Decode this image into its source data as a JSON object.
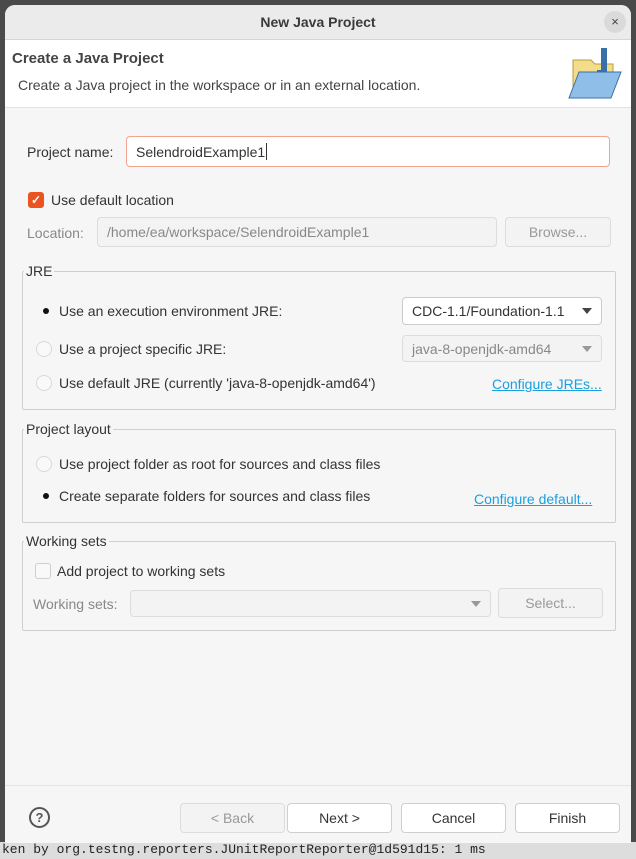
{
  "background": {
    "console_text": "ken by org.testng.reporters.JUnitReportReporter@1d591d15: 1 ms"
  },
  "dialog": {
    "title": "New Java Project",
    "close_icon": "×"
  },
  "header": {
    "title": "Create a Java Project",
    "description": "Create a Java project in the workspace or in an external location.",
    "icon": "java-project-folder-icon"
  },
  "form": {
    "project_name_label": "Project name:",
    "project_name_value": "SelendroidExample1",
    "use_default_location_label": "Use default location",
    "use_default_location_checked": true,
    "location_label": "Location:",
    "location_value": "/home/ea/workspace/SelendroidExample1",
    "browse_label": "Browse..."
  },
  "jre": {
    "legend": "JRE",
    "options": [
      {
        "label": "Use an execution environment JRE:",
        "selected": true
      },
      {
        "label": "Use a project specific JRE:",
        "selected": false
      },
      {
        "label": "Use default JRE (currently 'java-8-openjdk-amd64')",
        "selected": false
      }
    ],
    "execution_env_value": "CDC-1.1/Foundation-1.1",
    "project_jre_value": "java-8-openjdk-amd64",
    "configure_link": "Configure JREs..."
  },
  "layout": {
    "legend": "Project layout",
    "options": [
      {
        "label": "Use project folder as root for sources and class files",
        "selected": false
      },
      {
        "label": "Create separate folders for sources and class files",
        "selected": true
      }
    ],
    "configure_link": "Configure default..."
  },
  "working_sets": {
    "legend": "Working sets",
    "add_label": "Add project to working sets",
    "add_checked": false,
    "sets_label": "Working sets:",
    "sets_value": "",
    "select_label": "Select..."
  },
  "footer": {
    "help_icon": "?",
    "back": "< Back",
    "next": "Next >",
    "cancel": "Cancel",
    "finish": "Finish"
  },
  "colors": {
    "accent": "#e95420",
    "link": "#1a9fe0"
  }
}
